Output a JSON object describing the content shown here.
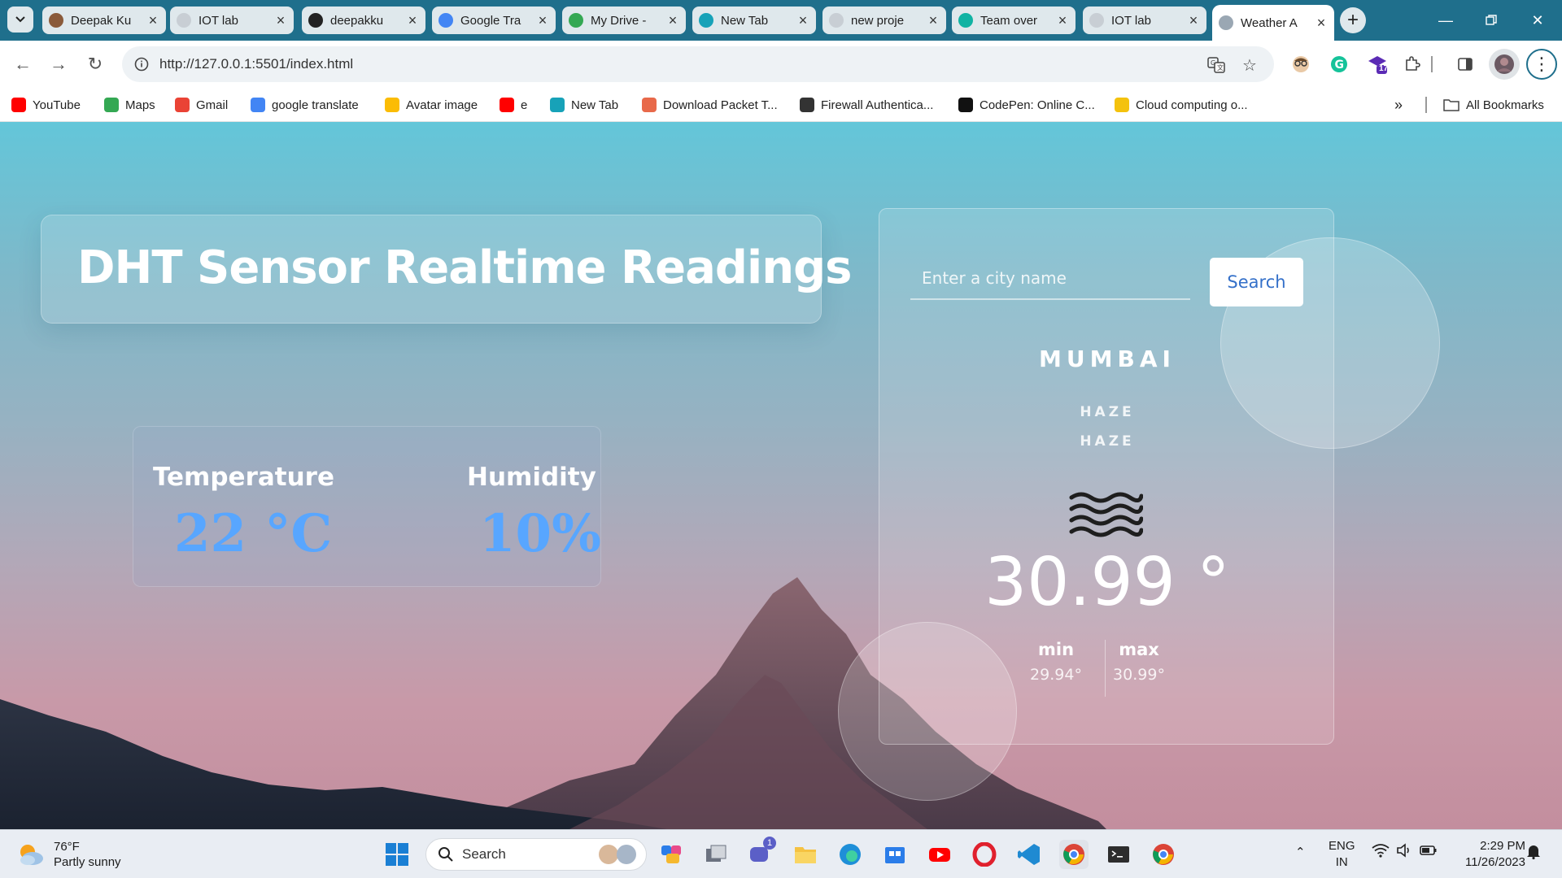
{
  "browser": {
    "tabs": [
      {
        "title": "Deepak Ku",
        "color": "#8a5a3a"
      },
      {
        "title": "IOT lab",
        "color": "#c8ced4"
      },
      {
        "title": "deepakku",
        "color": "#222222"
      },
      {
        "title": "Google Tra",
        "color": "#4285f4"
      },
      {
        "title": "My Drive -",
        "color": "#34a853"
      },
      {
        "title": "New Tab",
        "color": "#17a2b8"
      },
      {
        "title": "new proje",
        "color": "#c8ced4"
      },
      {
        "title": "Team over",
        "color": "#10b3a3"
      },
      {
        "title": "IOT lab",
        "color": "#c8ced4"
      },
      {
        "title": "Weather A",
        "color": "#9aa7b3"
      }
    ],
    "active_tab_index": 9,
    "url": "http://127.0.0.1:5501/index.html",
    "bookmarks": [
      {
        "label": "YouTube",
        "color": "#ff0000"
      },
      {
        "label": "Maps",
        "color": "#34a853"
      },
      {
        "label": "Gmail",
        "color": "#ea4335"
      },
      {
        "label": "google translate",
        "color": "#4285f4"
      },
      {
        "label": "Avatar image",
        "color": "#fbbc05"
      },
      {
        "label": "e",
        "color": "#ff0000"
      },
      {
        "label": "New Tab",
        "color": "#17a2b8"
      },
      {
        "label": "Download Packet T...",
        "color": "#e8694a"
      },
      {
        "label": "Firewall Authentica...",
        "color": "#333333"
      },
      {
        "label": "CodePen: Online C...",
        "color": "#111111"
      },
      {
        "label": "Cloud computing o...",
        "color": "#f4c20d"
      }
    ],
    "all_bookmarks_label": "All Bookmarks",
    "extension_badge": "17"
  },
  "page": {
    "heading": "DHT Sensor Realtime Readings",
    "temperature_label": "Temperature",
    "temperature_value": "22 °C",
    "humidity_label": "Humidity",
    "humidity_value": "10%",
    "accent_color": "#58a6ff"
  },
  "weather": {
    "input_placeholder": "Enter a city name",
    "input_value": "",
    "search_label": "Search",
    "city": "MUMBAI",
    "condition_main": "HAZE",
    "condition_desc": "HAZE",
    "icon": "haze-icon",
    "temperature": "30.99 °",
    "min_label": "min",
    "min_value": "29.94°",
    "max_label": "max",
    "max_value": "30.99°"
  },
  "taskbar": {
    "weather_temp": "76°F",
    "weather_desc": "Partly sunny",
    "search_label": "Search",
    "teams_badge": "1",
    "lang_line1": "ENG",
    "lang_line2": "IN",
    "time": "2:29 PM",
    "date": "11/26/2023"
  }
}
